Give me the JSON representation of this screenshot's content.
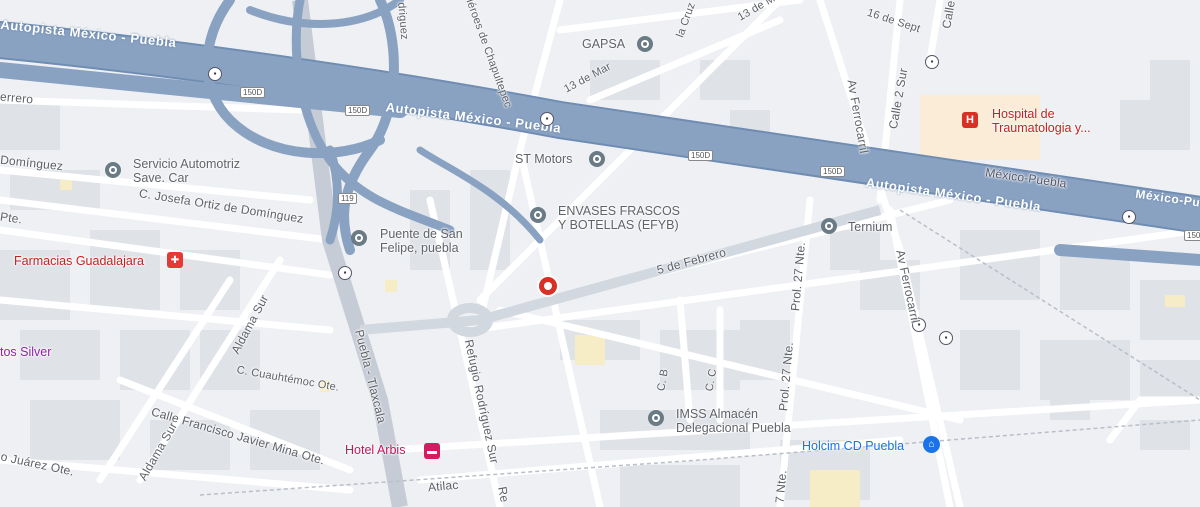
{
  "highways": {
    "autopista_1": "Autopista México - Puebla",
    "autopista_2": "Autopista México - Puebla",
    "autopista_3": "Autopista México - Puebla",
    "autopista_left": "Autopista México - Puebla",
    "mexico_puebla": "México-Puebla",
    "mexico_puebla_right": "México-Puebla"
  },
  "shields": {
    "s150d_1": "150D",
    "s150d_2": "150D",
    "s150d_3": "150D",
    "s150d_4": "150D",
    "s119": "119",
    "s150": "150"
  },
  "streets": {
    "errero": "errero",
    "dominguez": "Domínguez",
    "c_josefa": "C. Josefa Ortiz de Domínguez",
    "pte": "Pte.",
    "cinco_febrero": "5 de Febrero",
    "aldama_sur_1": "Aldama Sur",
    "aldama_sur_2": "Aldama Sur",
    "c_cuauhtemoc": "C. Cuauhtémoc Ote.",
    "calle_mina": "Calle Francisco Javier Mina Ote.",
    "juarez": "o Juárez Ote.",
    "puebla_tlaxcala": "Puebla - Tlaxcala",
    "refugio": "Refugio Rodríguez Sur",
    "atilac": "Atilac",
    "re_bottom": "Re",
    "c_b": "C. B",
    "c_c": "C. C",
    "prol_27_nte_1": "Prol. 27 Nte.",
    "prol_27_nte_2": "Prol. 27 Nte.",
    "seven_nte": "7 Nte.",
    "av_ferrocarril_1": "Av Ferrocarril",
    "av_ferrocarril_2": "Av Ferrocarril",
    "calle_2_sur": "Calle 2 Sur",
    "calle_top": "Calle",
    "sixteen_sept": "16 de Sept",
    "thirteen_mar_1": "13 de Mar",
    "thirteen_mar_2": "13 de M",
    "la_cruz": "la Cruz",
    "driguez": "driguez",
    "chapultepec": "Héroes de Chapultepec"
  },
  "pois": {
    "gapsa": "GAPSA",
    "hospital_line1": "Hospital de",
    "hospital_line2": "Traumatologia y...",
    "servicio_line1": "Servicio Automotriz",
    "servicio_line2": "Save. Car",
    "st_motors": "ST Motors",
    "envases_line1": "ENVASES FRASCOS",
    "envases_line2": "Y BOTELLAS (EFYB)",
    "ternium": "Ternium",
    "puente_line1": "Puente de San",
    "puente_line2": "Felipe, puebla",
    "farmacias": "Farmacias Guadalajara",
    "tos_silver": "tos Silver",
    "imss_line1": "IMSS Almacén",
    "imss_line2": "Delegacional Puebla",
    "hotel_arbis": "Hotel Arbis",
    "holcim": "Holcim CD Puebla"
  },
  "icons": {
    "hospital": "hospital-icon",
    "pharmacy": "pharmacy-icon",
    "hotel": "hotel-icon",
    "store": "store-icon",
    "place": "place-marker-icon",
    "bus": "bus-stop-icon",
    "pin": "location-pin-icon"
  },
  "colors": {
    "land": "#eef0f3",
    "highway": "#8aa2c2",
    "highway_edge": "#6f8db3",
    "road": "#ffffff",
    "block": "#dfe2e7",
    "park": "#f6edc6",
    "hospital_area": "#fbecd8",
    "pin": "#d93025"
  }
}
